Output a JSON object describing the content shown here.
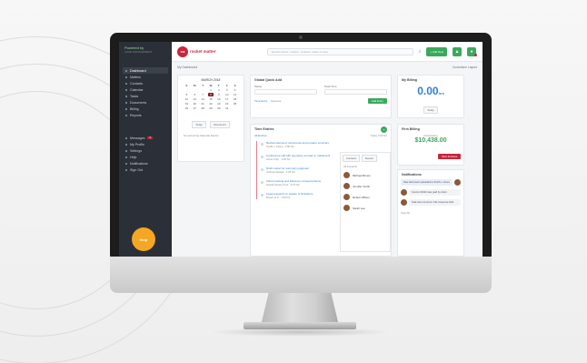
{
  "sidebar": {
    "brand": "Powered by",
    "brand_sub": "CASE MANAGEMENT",
    "nav_top": [
      {
        "label": "Dashboard",
        "active": true
      },
      {
        "label": "Matters"
      },
      {
        "label": "Contacts"
      },
      {
        "label": "Calendar"
      },
      {
        "label": "Tasks"
      },
      {
        "label": "Documents"
      },
      {
        "label": "Billing"
      },
      {
        "label": "Reports"
      }
    ],
    "nav_bottom": [
      {
        "label": "Messages",
        "badge": "3"
      },
      {
        "label": "My Profile"
      },
      {
        "label": "Settings"
      },
      {
        "label": "Help"
      },
      {
        "label": "Notifications"
      },
      {
        "label": "Sign Out"
      }
    ],
    "help_label": "Help"
  },
  "topbar": {
    "logo_mark": "RM",
    "logo_text": "rocket matter",
    "search_placeholder": "Search clients, matters, contacts, tasks & more",
    "search_icon": "search-icon",
    "new_button": "+ Add New",
    "icon_a": "bell-icon",
    "icon_b": "user-icon"
  },
  "content": {
    "breadcrumb": "My Dashboard",
    "breadcrumb_right": "Customize Layout",
    "calendar": {
      "month": "MARCH 2018",
      "days": [
        "S",
        "M",
        "T",
        "W",
        "T",
        "F",
        "S"
      ],
      "dates": [
        "",
        "",
        "",
        "1",
        "2",
        "3",
        "4",
        "5",
        "6",
        "7",
        "8",
        "9",
        "10",
        "11",
        "12",
        "13",
        "14",
        "15",
        "16",
        "17",
        "18",
        "19",
        "20",
        "21",
        "22",
        "23",
        "24",
        "25",
        "26",
        "27",
        "28",
        "29",
        "30",
        "31",
        ""
      ],
      "selected": "8",
      "btn_today": "Today",
      "btn_new": "New Event",
      "empty_text": "No Upcoming Calendar Events"
    },
    "quick_add": {
      "title": "Global Quick Add",
      "field1": "Matter",
      "field2": "Date/Time",
      "option1": "Time Entry",
      "option2": "Expense",
      "submit": "Add Entry"
    },
    "my_billing": {
      "title": "My Billing",
      "value": "0.00",
      "unit": "hrs",
      "period": "Today"
    },
    "timekeeping": {
      "title": "Time Entries",
      "link": "All Entries",
      "summary": "Today 0.00 hrs",
      "items": [
        {
          "title": "Review discovery documents and prepare summary",
          "sub": "Smith v. Jones · 0.50 hrs"
        },
        {
          "title": "Conference call with opposing counsel re: settlement",
          "sub": "Acme Corp · 1.00 hrs"
        },
        {
          "title": "Draft motion for summary judgment",
          "sub": "Johnson Estate · 2.25 hrs"
        },
        {
          "title": "Client meeting and follow-up correspondence",
          "sub": "Garcia Family Trust · 0.75 hrs"
        },
        {
          "title": "Legal research on statute of limitations",
          "sub": "Brown LLC · 1.50 hrs"
        }
      ]
    },
    "contacts": {
      "tab1": "Contacts",
      "tab2": "Recent",
      "filter": "All Contacts",
      "items": [
        "Michael Brown",
        "Jennifer Smith",
        "Robert Wilson",
        "Sarah Lee"
      ]
    },
    "firm_billing": {
      "title": "Firm Billing",
      "label": "Outstanding",
      "value": "$10,438.00",
      "action": "View Invoices"
    },
    "notifications": {
      "title": "Notifications",
      "messages": [
        "New document uploaded to Smith v. Jones",
        "Invoice #1042 was paid by client",
        "Task due tomorrow: File response brief"
      ],
      "footer": "View All"
    }
  }
}
